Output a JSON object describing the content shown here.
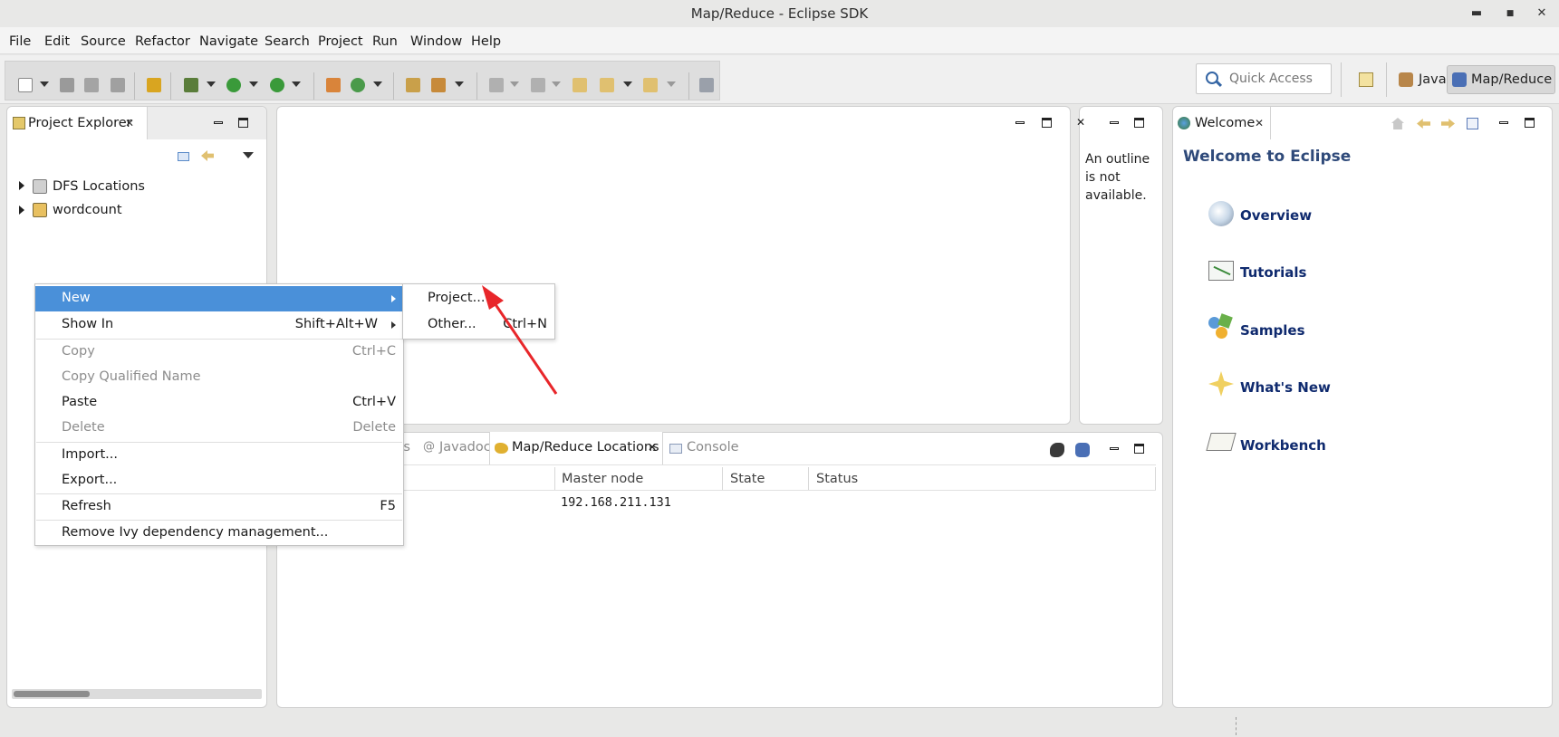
{
  "window": {
    "title": "Map/Reduce - Eclipse SDK",
    "minimize": "▬",
    "maximize": "■",
    "close": "✕"
  },
  "menubar": {
    "items": [
      "File",
      "Edit",
      "Source",
      "Refactor",
      "Navigate",
      "Search",
      "Project",
      "Run",
      "Window",
      "Help"
    ]
  },
  "toolbar": {
    "quick_access_placeholder": "Quick Access",
    "perspectives": [
      {
        "label": "Java",
        "active": false
      },
      {
        "label": "Map/Reduce",
        "active": true
      }
    ]
  },
  "project_explorer": {
    "tab_label": "Project Explorer",
    "items": [
      {
        "label": "DFS Locations",
        "icon": "dfs-locations-icon"
      },
      {
        "label": "wordcount",
        "icon": "java-project-icon"
      }
    ]
  },
  "context_menu": {
    "items": [
      {
        "label": "New",
        "shortcut": "",
        "submenu": true,
        "enabled": true,
        "highlighted": true
      },
      {
        "label": "Show In",
        "shortcut": "Shift+Alt+W",
        "submenu": true,
        "enabled": true
      },
      {
        "label": "Copy",
        "shortcut": "Ctrl+C",
        "enabled": false
      },
      {
        "label": "Copy Qualified Name",
        "shortcut": "",
        "enabled": false
      },
      {
        "label": "Paste",
        "shortcut": "Ctrl+V",
        "enabled": true
      },
      {
        "label": "Delete",
        "shortcut": "Delete",
        "enabled": false
      },
      {
        "label": "Import...",
        "shortcut": "",
        "enabled": true
      },
      {
        "label": "Export...",
        "shortcut": "",
        "enabled": true
      },
      {
        "label": "Refresh",
        "shortcut": "F5",
        "enabled": true
      },
      {
        "label": "Remove Ivy dependency management...",
        "shortcut": "",
        "enabled": true
      }
    ],
    "submenu": [
      {
        "label": "Project...",
        "shortcut": ""
      },
      {
        "label": "Other...",
        "shortcut": "Ctrl+N"
      }
    ]
  },
  "outline": {
    "message": "An outline is not available."
  },
  "bottom_panel": {
    "tabs": [
      {
        "label": "ks",
        "active": false
      },
      {
        "label": "Javadoc",
        "active": false
      },
      {
        "label": "Map/Reduce Locations",
        "active": true
      },
      {
        "label": "Console",
        "active": false
      }
    ],
    "columns": [
      "Master node",
      "State",
      "Status"
    ],
    "rows": [
      {
        "master_node": "192.168.211.131",
        "state": "",
        "status": ""
      }
    ]
  },
  "welcome": {
    "tab_label": "Welcome",
    "heading": "Welcome to Eclipse",
    "links": [
      {
        "label": "Overview",
        "icon": "overview-icon"
      },
      {
        "label": "Tutorials",
        "icon": "tutorials-icon"
      },
      {
        "label": "Samples",
        "icon": "samples-icon"
      },
      {
        "label": "What's New",
        "icon": "whats-new-icon"
      },
      {
        "label": "Workbench",
        "icon": "workbench-icon"
      }
    ]
  },
  "colors": {
    "menu_highlight": "#4a90d9",
    "welcome_link": "#0f2a6e",
    "annotation_arrow": "#e8262a"
  }
}
